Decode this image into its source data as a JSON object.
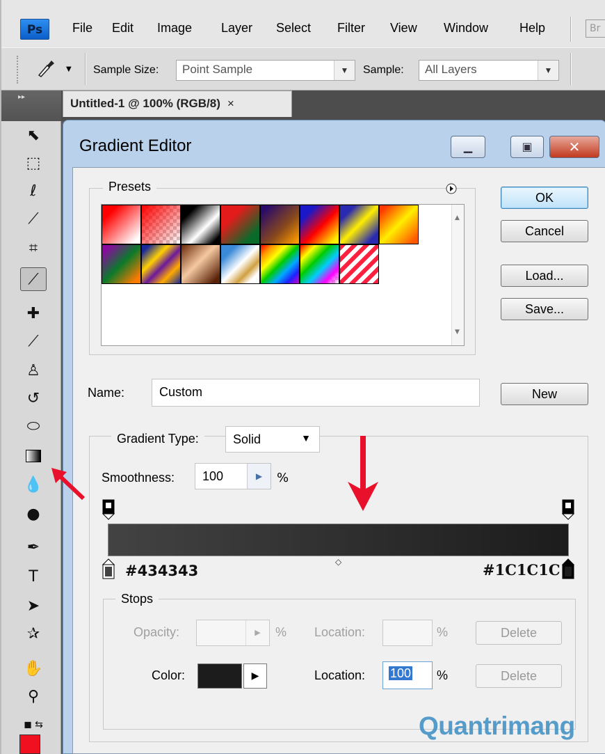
{
  "app": {
    "logo": "Ps",
    "bridge": "Br"
  },
  "menu": [
    "File",
    "Edit",
    "Image",
    "Layer",
    "Select",
    "Filter",
    "View",
    "Window",
    "Help"
  ],
  "options": {
    "sample_size_label": "Sample Size:",
    "sample_size_value": "Point Sample",
    "sample_label": "Sample:",
    "sample_value": "All Layers"
  },
  "document": {
    "tab_title": "Untitled-1 @ 100% (RGB/8)",
    "close": "×"
  },
  "tools": [
    "move-icon",
    "marquee-icon",
    "lasso-icon",
    "magic-wand-icon",
    "crop-icon",
    "eyedropper-icon",
    "healing-brush-icon",
    "brush-icon",
    "clone-stamp-icon",
    "history-brush-icon",
    "eraser-icon",
    "gradient-icon",
    "blur-icon",
    "dodge-icon",
    "pen-icon",
    "type-icon",
    "path-selection-icon",
    "shape-icon",
    "hand-icon",
    "zoom-icon"
  ],
  "colors": {
    "foreground": "#f01020",
    "background": "#ffffff",
    "accent": "#3378d0"
  },
  "dialog": {
    "title": "Gradient Editor",
    "presets_legend": "Presets",
    "buttons": {
      "ok": "OK",
      "cancel": "Cancel",
      "load": "Load...",
      "save": "Save...",
      "new": "New"
    },
    "name_label": "Name:",
    "name_value": "Custom",
    "gradient_type_label": "Gradient Type:",
    "gradient_type_value": "Solid",
    "smoothness_label": "Smoothness:",
    "smoothness_value": "100",
    "percent": "%",
    "left_color": "#434343",
    "right_color": "#1C1C1C",
    "stops_legend": "Stops",
    "opacity_label": "Opacity:",
    "location_label": "Location:",
    "location_label2": "Location:",
    "color_label": "Color:",
    "location_value": "100",
    "delete_label": "Delete"
  },
  "watermark": "Quantrimang"
}
